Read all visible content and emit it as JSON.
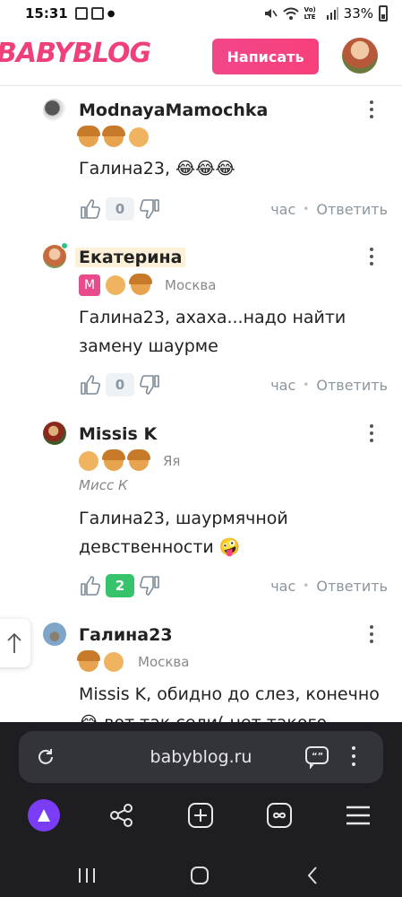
{
  "status_bar": {
    "time": "15:31",
    "battery": "33%",
    "lte_label": "Vo) LTE"
  },
  "header": {
    "logo": "BABYBLOG",
    "write_button": "Написать"
  },
  "comments": [
    {
      "author": "ModnayaMamochka",
      "location": "",
      "status": "",
      "reply_to": "Галина23",
      "text": ", 😂😂😂",
      "likes": "0",
      "time": "час",
      "reply_label": "Ответить"
    },
    {
      "author": "Екатерина",
      "location": "Москва",
      "status": "",
      "badge_letter": "M",
      "reply_to": "Галина23",
      "text": ", ахаха...надо найти замену шаурме",
      "likes": "0",
      "time": "час",
      "reply_label": "Ответить"
    },
    {
      "author": "Missis K",
      "location": "Яя",
      "status": "Мисс К",
      "reply_to": "Галина23",
      "text": ", шаурмячной девственности 🤪",
      "likes": "2",
      "time": "час",
      "reply_label": "Ответить"
    },
    {
      "author": "Галина23",
      "location": "Москва",
      "status": "",
      "reply_to": "Missis K",
      "text": ", обидно до слез, конечно 😂 вот так сели( нет такого",
      "likes": "",
      "time": "",
      "reply_label": ""
    }
  ],
  "browser": {
    "url": "babyblog.ru"
  },
  "icons": {
    "reload": "reload-icon",
    "reader": "reader-mode-icon",
    "menu": "kebab-icon",
    "alice": "alice-icon",
    "share": "share-icon",
    "new_tab": "new-tab-icon",
    "tabs": "tabs-icon",
    "hamburger": "hamburger-icon",
    "up": "arrow-up-icon"
  },
  "colors": {
    "brand_pink": "#f0407a",
    "like_positive": "#36c36c",
    "browser_bg": "#1d1d22"
  }
}
